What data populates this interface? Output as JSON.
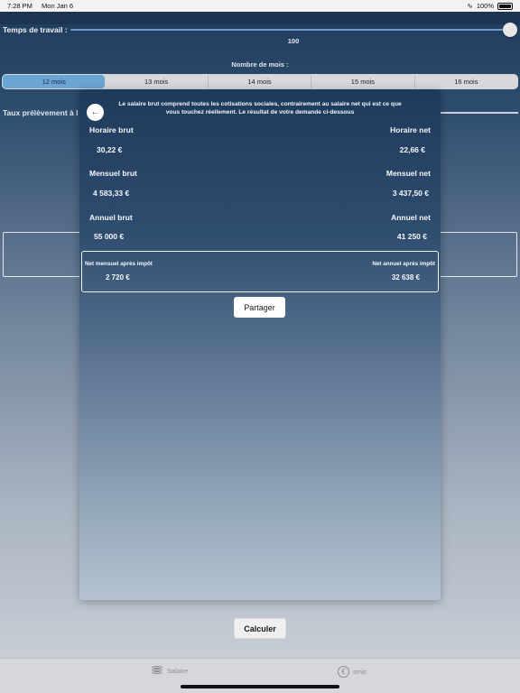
{
  "status_bar": {
    "time": "7:28 PM",
    "date": "Mon Jan 6",
    "battery": "100%"
  },
  "form": {
    "work_time_label": "Temps de travail :",
    "work_time_value": 100,
    "work_time_value_text": "100",
    "months_label": "Nombre de mois :",
    "months_options": [
      "12 mois",
      "13 mois",
      "14 mois",
      "15 mois",
      "16 mois"
    ],
    "months_selected": "12 mois",
    "taux_label": "Taux prélèvement à l",
    "calculate_label": "Calculer"
  },
  "modal": {
    "intro": "Le salaire brut comprend toutes les cotisations sociales, contrairement au salaire net qui est ce que vous touchez réellement. Le résultat de votre demande ci-dessous",
    "hourly_gross_label": "Horaire brut",
    "hourly_gross_value": "30,22 €",
    "hourly_net_label": "Horaire net",
    "hourly_net_value": "22,66 €",
    "monthly_gross_label": "Mensuel brut",
    "monthly_gross_value": "4 583,33 €",
    "monthly_net_label": "Mensuel net",
    "monthly_net_value": "3 437,50 €",
    "annual_gross_label": "Annuel brut",
    "annual_gross_value": "55 000 €",
    "annual_net_label": "Annuel net",
    "annual_net_value": "41 250 €",
    "monthly_after_tax_label": "Net mensuel après impôt",
    "monthly_after_tax_value": "2 720 €",
    "annual_after_tax_label": "Net annuel après impôt",
    "annual_after_tax_value": "32 638 €",
    "share_label": "Partager",
    "back_icon": "arrow-left-icon"
  },
  "tabbar": {
    "tabs": [
      {
        "label": "Salaire",
        "icon": "coins-icon"
      },
      {
        "label": "smic",
        "icon": "euro-circle-icon"
      }
    ]
  },
  "colors": {
    "accent": "#6aa5d6",
    "background_top": "#1f3a5a",
    "background_bottom": "#cfd3d9"
  }
}
